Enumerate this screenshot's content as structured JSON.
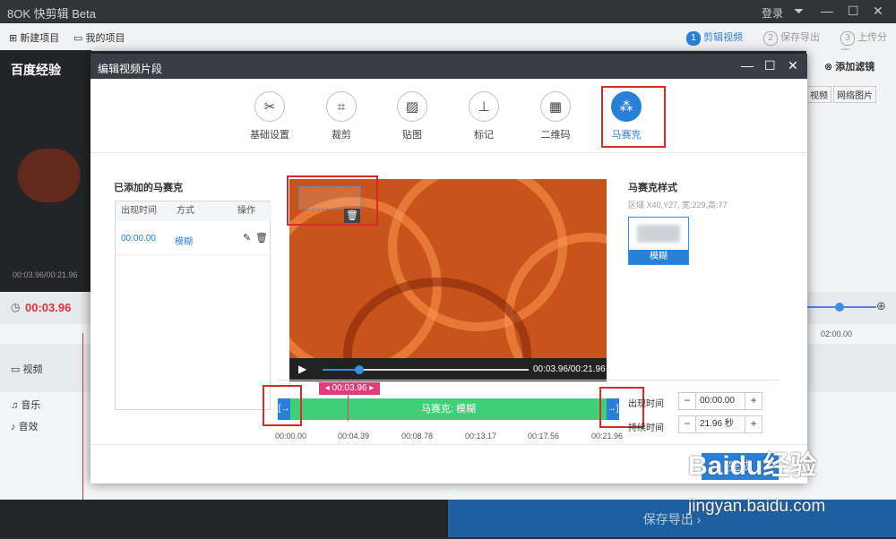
{
  "app": {
    "logo": "8OK 快剪辑 Beta",
    "login": "登录"
  },
  "toolbar": {
    "new_project": "新建项目",
    "my_projects": "我的项目",
    "steps": [
      {
        "num": "1",
        "label": "剪辑视频"
      },
      {
        "num": "2",
        "label": "保存导出"
      },
      {
        "num": "3",
        "label": "上传分享"
      }
    ]
  },
  "background": {
    "preview_title": "百度经验",
    "preview_time": "00:03.96/00:21.96",
    "current_time": "00:03.96",
    "add_filter": "添加滤镜",
    "video_btn": "视频",
    "net_image_btn": "网络图片",
    "ruler_time": "02:00.00",
    "tracks": [
      "视频",
      "音乐",
      "音效"
    ],
    "save_export": "保存导出"
  },
  "dialog": {
    "title": "编辑视频片段",
    "tools": [
      {
        "label": "基础设置",
        "icon": "scissors-icon"
      },
      {
        "label": "裁剪",
        "icon": "crop-icon"
      },
      {
        "label": "贴图",
        "icon": "image-icon"
      },
      {
        "label": "标记",
        "icon": "pin-icon"
      },
      {
        "label": "二维码",
        "icon": "qrcode-icon"
      },
      {
        "label": "马赛克",
        "icon": "mosaic-icon"
      }
    ],
    "added_title": "已添加的马赛克",
    "table": {
      "headers": [
        "出现时间",
        "方式",
        "操作"
      ],
      "rows": [
        {
          "time": "00:00.00",
          "method": "模糊"
        }
      ]
    },
    "video_time": "00:03.96/00:21.96",
    "video_progress": 0.18,
    "style_title": "马赛克样式",
    "region_text": "区域 X40,Y27, 宽:229,高:77",
    "style_option": "模糊",
    "playhead_label": "00:03.96",
    "track_label": "马赛克: 模糊",
    "ticks": [
      "00:00.00",
      "00:04.39",
      "00:08.78",
      "00:13.17",
      "00:17.56",
      "00:21.96"
    ],
    "appear_label": "出现时间",
    "appear_value": "00:00.00",
    "duration_label": "持续时间",
    "duration_value": "21.96 秒",
    "done": "完成"
  },
  "watermark": {
    "main": "Baidu经验",
    "sub": "jingyan.baidu.com"
  }
}
